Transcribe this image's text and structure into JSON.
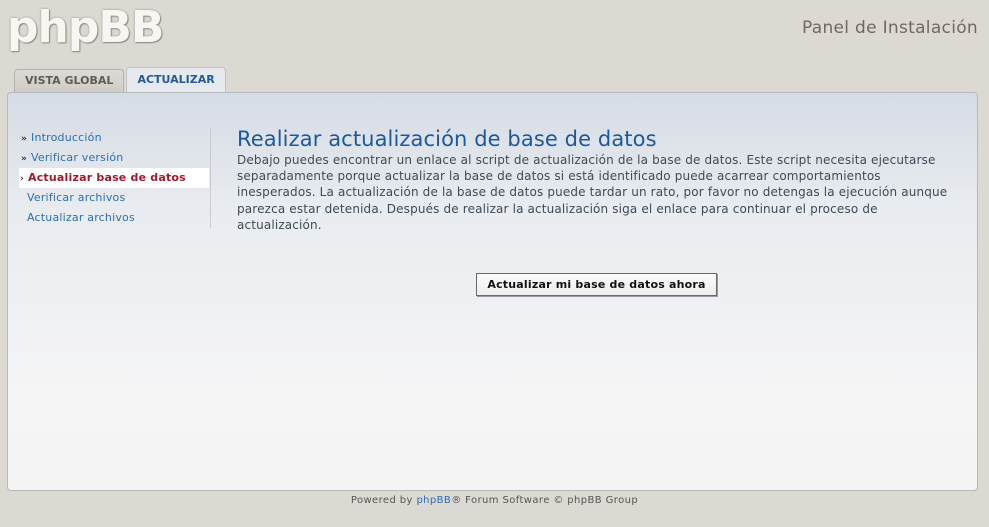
{
  "header": {
    "logo_text": "phpBB",
    "panel_title": "Panel de Instalación"
  },
  "tabs": [
    {
      "label": "VISTA GLOBAL",
      "active": false
    },
    {
      "label": "ACTUALIZAR",
      "active": true
    }
  ],
  "menu": {
    "items": [
      {
        "label": "Introducción",
        "state": "done"
      },
      {
        "label": "Verificar versión",
        "state": "done"
      },
      {
        "label": "Actualizar base de datos",
        "state": "current"
      },
      {
        "label": "Verificar archivos",
        "state": "pending"
      },
      {
        "label": "Actualizar archivos",
        "state": "pending"
      }
    ]
  },
  "content": {
    "title": "Realizar actualización de base de datos",
    "body": "Debajo puedes encontrar un enlace al script de actualización de la base de datos. Este script necesita ejecutarse separadamente porque actualizar la base de datos si está identificado puede acarrear comportamientos inesperados. La actualización de la base de datos puede tardar un rato, por favor no detengas la ejecución aunque parezca estar detenida. Después de realizar la actualización siga el enlace para continuar el proceso de actualización.",
    "button_label": "Actualizar mi base de datos ahora"
  },
  "footer": {
    "prefix": "Powered by ",
    "link": "phpBB",
    "suffix": "® Forum Software © phpBB Group"
  },
  "icons": {
    "done_marker": "chevron-double-icon",
    "current_marker": "chevron-right-icon"
  },
  "colors": {
    "link": "#2a6fb3",
    "current": "#a01a2c",
    "title": "#1a5a9c"
  }
}
